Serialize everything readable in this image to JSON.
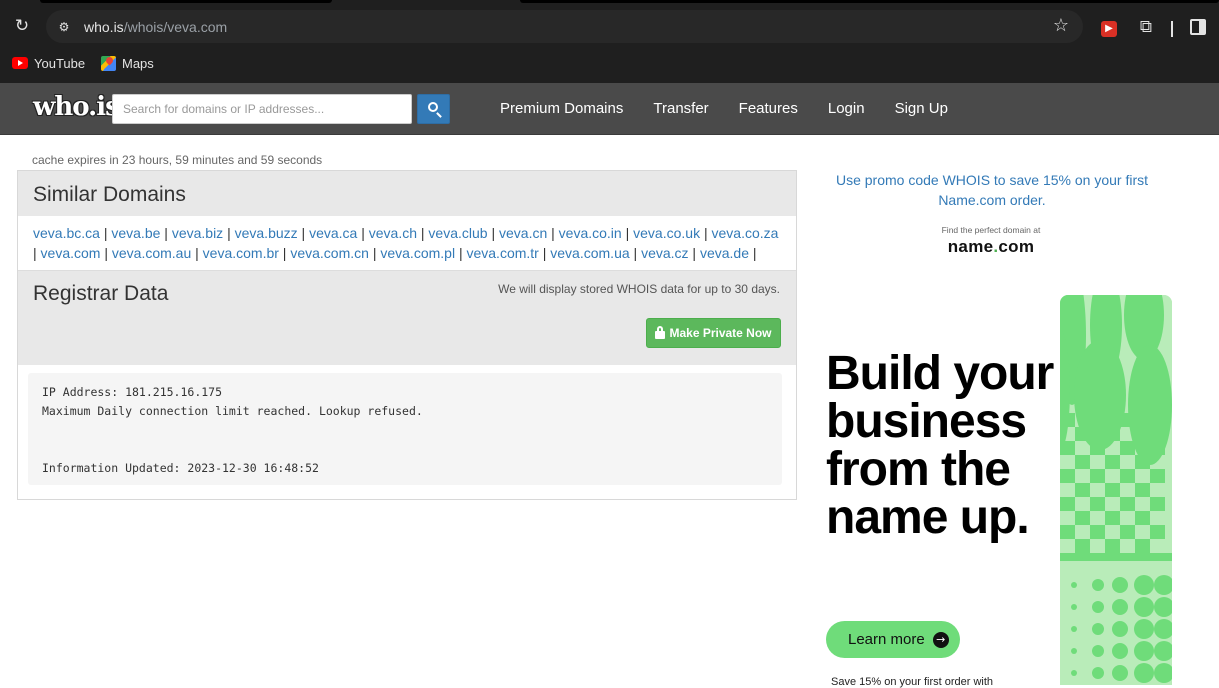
{
  "browser": {
    "url_host": "who.is",
    "url_path": "/whois/veva.com",
    "bookmarks": [
      {
        "label": "YouTube",
        "icon": "youtube-icon"
      },
      {
        "label": "Maps",
        "icon": "maps-icon"
      }
    ]
  },
  "site": {
    "logo": "who.is",
    "search_placeholder": "Search for domains or IP addresses...",
    "nav": [
      "Premium Domains",
      "Transfer",
      "Features",
      "Login",
      "Sign Up"
    ]
  },
  "main": {
    "cache_text": "cache expires in 23 hours, 59 minutes and 59 seconds",
    "similar_title": "Similar Domains",
    "similar_domains": [
      "veva.bc.ca",
      "veva.be",
      "veva.biz",
      "veva.buzz",
      "veva.ca",
      "veva.ch",
      "veva.club",
      "veva.cn",
      "veva.co.in",
      "veva.co.uk",
      "veva.co.za",
      "veva.com",
      "veva.com.au",
      "veva.com.br",
      "veva.com.cn",
      "veva.com.pl",
      "veva.com.tr",
      "veva.com.ua",
      "veva.cz",
      "veva.de"
    ],
    "registrar_title": "Registrar Data",
    "stored_note": "We will display stored WHOIS data for up to 30 days.",
    "private_button": "Make Private Now",
    "raw_lines": {
      "ip": "IP Address: 181.215.16.175",
      "limit": "Maximum Daily connection limit reached. Lookup refused.",
      "updated": "Information Updated: 2023-12-30 16:48:52"
    }
  },
  "sidebar": {
    "promo": "Use promo code WHOIS to save 15% on your first Name.com order.",
    "find_perfect": "Find the perfect domain at",
    "brand_name": "name",
    "brand_dot": ".",
    "brand_tld": "com",
    "headline": "Build your business from the name up.",
    "learn_more": "Learn more",
    "footnote": "Save 15% on your first order with"
  },
  "colors": {
    "link": "#337ab7",
    "nav_bg": "#4a4a4a",
    "button_green": "#5cb85c",
    "ad_green": "#6fdc7a"
  }
}
